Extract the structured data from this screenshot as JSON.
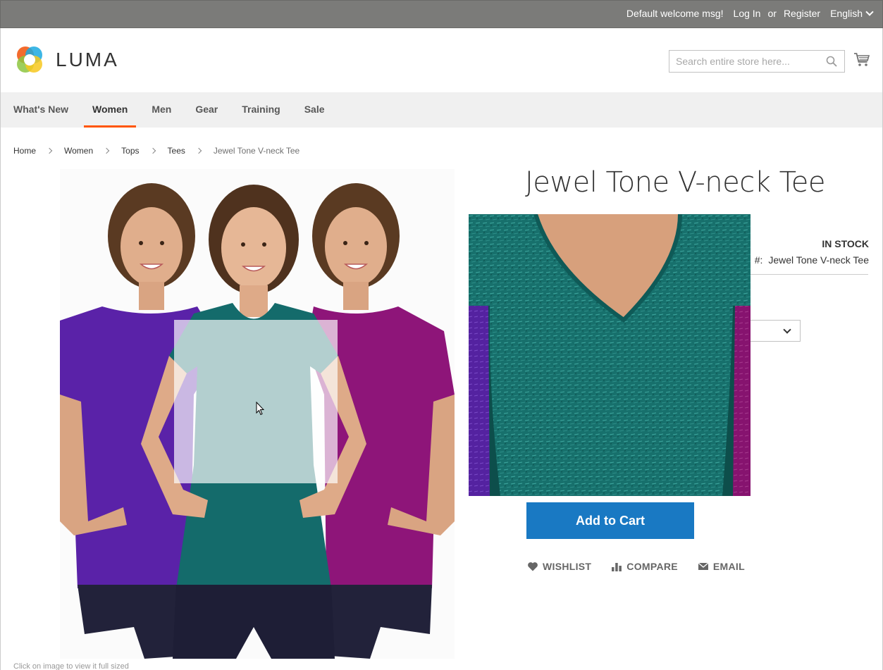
{
  "topbar": {
    "welcome": "Default welcome msg!",
    "login": "Log In",
    "or": "or",
    "register": "Register",
    "language": "English"
  },
  "header": {
    "logo_text": "LUMA",
    "search_placeholder": "Search entire store here..."
  },
  "nav": {
    "items": [
      {
        "label": "What's New",
        "active": false
      },
      {
        "label": "Women",
        "active": true
      },
      {
        "label": "Men",
        "active": false
      },
      {
        "label": "Gear",
        "active": false
      },
      {
        "label": "Training",
        "active": false
      },
      {
        "label": "Sale",
        "active": false
      }
    ]
  },
  "breadcrumb": {
    "items": [
      "Home",
      "Women",
      "Tops",
      "Tees"
    ],
    "current": "Jewel Tone V-neck Tee"
  },
  "product": {
    "title": "Jewel Tone V-neck Tee",
    "stock": "In stock",
    "sku_label": "#:",
    "sku": "Jewel Tone V-neck Tee",
    "add_to_cart": "Add to Cart",
    "gallery_caption": "Click on image to view it full sized",
    "shirt_colors": [
      "#5a22a8",
      "#146b6b",
      "#8e1579"
    ]
  },
  "actions": {
    "wishlist": "Wishlist",
    "compare": "Compare",
    "email": "Email"
  },
  "colors": {
    "topbar_bg": "#7b7b79",
    "nav_bg": "#f0f0f0",
    "nav_active_underline": "#ff5501",
    "primary_button": "#1979c3"
  }
}
